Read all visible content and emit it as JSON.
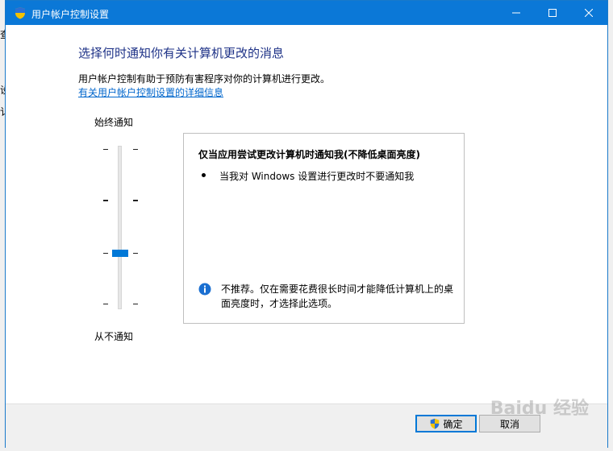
{
  "window": {
    "title": "用户帐户控制设置"
  },
  "background_fragments": [
    "查",
    "设",
    "讠"
  ],
  "main": {
    "heading": "选择何时通知你有关计算机更改的消息",
    "description": "用户帐户控制有助于预防有害程序对你的计算机进行更改。",
    "link_text": "有关用户帐户控制设置的详细信息"
  },
  "slider": {
    "top_label": "始终通知",
    "bottom_label": "从不通知",
    "levels": 4,
    "selected_level": 2
  },
  "panel": {
    "title": "仅当应用尝试更改计算机时通知我(不降低桌面亮度)",
    "bullet": "当我对 Windows 设置进行更改时不要通知我",
    "note": "不推荐。仅在需要花费很长时间才能降低计算机上的桌面亮度时，才选择此选项。",
    "note_icon": "info-icon"
  },
  "footer": {
    "ok_label": "确定",
    "cancel_label": "取消"
  },
  "watermark": "Baidu 经验",
  "colors": {
    "titlebar": "#0b78d7",
    "heading": "#1e3287",
    "link": "#0066cc",
    "accent": "#0078d7"
  }
}
